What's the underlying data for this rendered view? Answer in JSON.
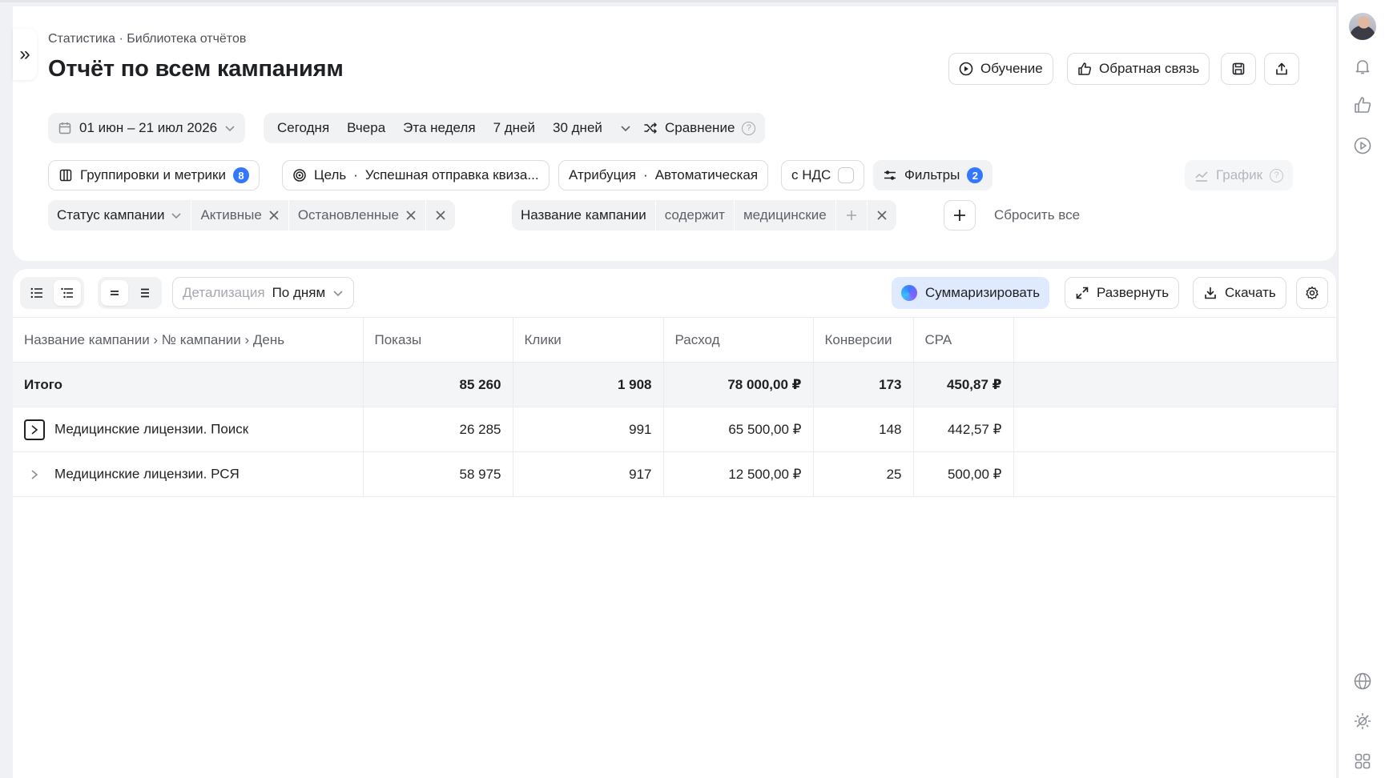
{
  "breadcrumb": "Статистика · Библиотека отчётов",
  "page_title": "Отчёт по всем кампаниям",
  "header_buttons": {
    "learning": "Обучение",
    "feedback": "Обратная связь"
  },
  "dates": {
    "range": "01 июн – 21 июл 2026",
    "presets": [
      "Сегодня",
      "Вчера",
      "Эта неделя",
      "7 дней",
      "30 дней"
    ],
    "compare": "Сравнение"
  },
  "settings_row": {
    "groupings": "Группировки и метрики",
    "groupings_count": "8",
    "goal_prefix": "Цель",
    "goal_value": "Успешная отправка квиза...",
    "attribution_prefix": "Атрибуция",
    "attribution_value": "Автоматическая",
    "vat": "с НДС",
    "filters": "Фильтры",
    "filters_count": "2",
    "chart": "График"
  },
  "filters_row": {
    "status_field": "Статус кампании",
    "status_values": [
      "Активные",
      "Остановленные"
    ],
    "name_field": "Название кампании",
    "name_operator": "содержит",
    "name_value": "медицинские",
    "reset": "Сбросить все"
  },
  "toolbar": {
    "detail_label": "Детализация",
    "detail_value": "По дням",
    "summarize": "Суммаризировать",
    "expand": "Развернуть",
    "download": "Скачать"
  },
  "table": {
    "columns": [
      "Название кампании › № кампании › День",
      "Показы",
      "Клики",
      "Расход",
      "Конверсии",
      "CPA"
    ],
    "total": {
      "label": "Итого",
      "impressions": "85 260",
      "clicks": "1 908",
      "cost": "78 000,00 ₽",
      "conversions": "173",
      "cpa": "450,87 ₽"
    },
    "rows": [
      {
        "name": "Медицинские лицензии. Поиск",
        "impressions": "26 285",
        "clicks": "991",
        "cost": "65 500,00 ₽",
        "conversions": "148",
        "cpa": "442,57 ₽"
      },
      {
        "name": "Медицинские лицензии. РСЯ",
        "impressions": "58 975",
        "clicks": "917",
        "cost": "12 500,00 ₽",
        "conversions": "25",
        "cpa": "500,00 ₽"
      }
    ]
  },
  "colors": {
    "accent": "#3377ff",
    "summarize_bg": "#dfeaff",
    "page_bg": "#f0f1f4"
  }
}
